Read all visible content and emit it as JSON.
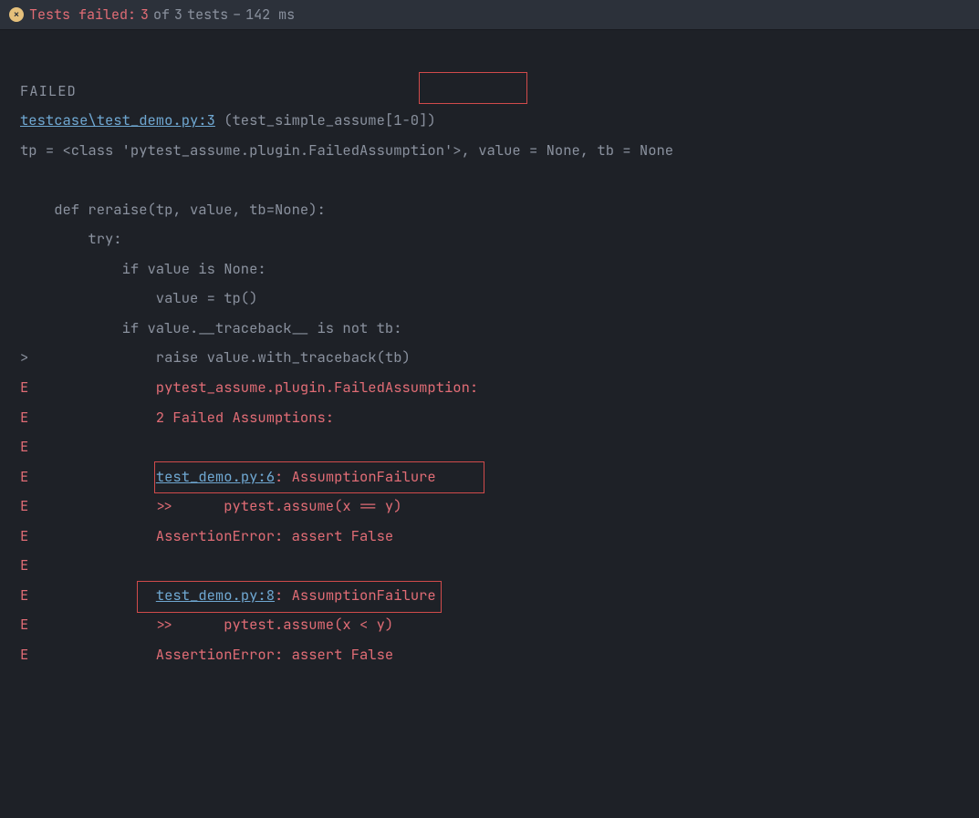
{
  "header": {
    "tests_failed_label": "Tests failed:",
    "failed_count": "3",
    "of_label": "of",
    "total_count": "3",
    "tests_word": "tests",
    "dash": "–",
    "duration": "142 ms"
  },
  "lines": {
    "l0": "FAILED",
    "l1_link": "testcase\\test_demo.py:3",
    "l1_after": " (test_simple_assume[1-0])",
    "l2": "tp = <class 'pytest_assume.plugin.FailedAssumption'>, value = None, tb = None",
    "l3": "",
    "l4": "    def reraise(tp, value, tb=None):",
    "l5": "        try:",
    "l6": "            if value is None:",
    "l7": "                value = tp()",
    "l8": "            if value.__traceback__ is not tb:",
    "l9": ">               raise value.with_traceback(tb)",
    "l10": "E               pytest_assume.plugin.FailedAssumption: ",
    "l11": "E               2 Failed Assumptions:",
    "l12": "E               ",
    "l13_pre": "E               ",
    "l13_link": "test_demo.py:6",
    "l13_post": ": AssumptionFailure",
    "l14": "E               >>\tpytest.assume(x == y)",
    "l15": "E               AssertionError: assert False",
    "l16": "E               ",
    "l17_pre": "E               ",
    "l17_link": "test_demo.py:8",
    "l17_post": ": AssumptionFailure",
    "l18": "E               >>\tpytest.assume(x < y)",
    "l19": "E               AssertionError: assert False"
  }
}
